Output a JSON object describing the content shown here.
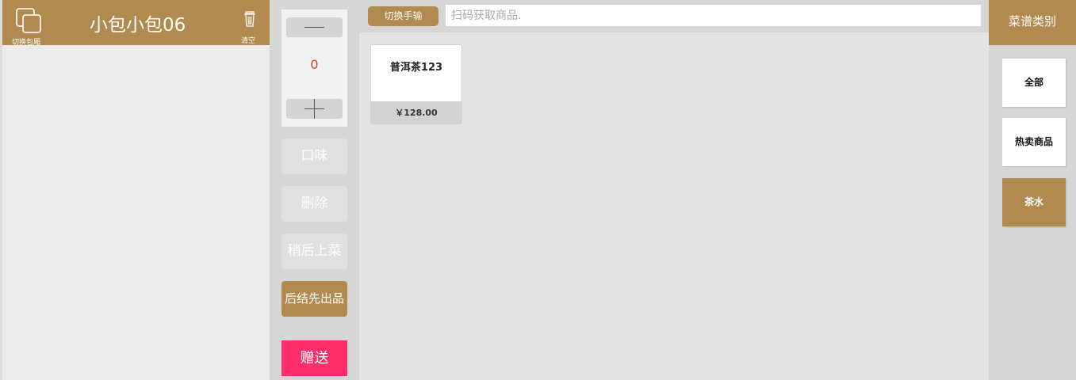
{
  "order": {
    "switch_room_label": "切换包厢",
    "room_name": "小包小包06",
    "clear_label": "清空"
  },
  "controls": {
    "quantity": "0",
    "taste_label": "口味",
    "delete_label": "删除",
    "serve_later_label": "稍后上菜",
    "serve_first_label": "后结先出品",
    "gift_label": "赠送"
  },
  "search": {
    "switch_input_label": "切换手输",
    "placeholder": "扫码获取商品."
  },
  "products": [
    {
      "name": "普洱茶123",
      "price": "￥128.00"
    }
  ],
  "categories": {
    "title": "菜谱类别",
    "items": [
      {
        "label": "全部",
        "selected": false
      },
      {
        "label": "热卖商品",
        "selected": false
      },
      {
        "label": "茶水",
        "selected": true
      }
    ]
  },
  "colors": {
    "brand": "#b08a4e",
    "gift": "#ff2e6a",
    "quantity": "#e23a1e"
  }
}
